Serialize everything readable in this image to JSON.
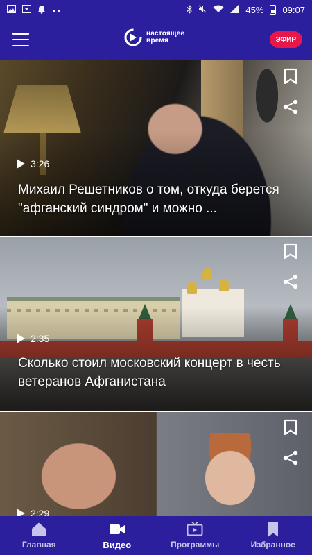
{
  "status_bar": {
    "battery": "45%",
    "time": "09:07",
    "left_icons": [
      "image-icon",
      "download-icon",
      "notification-icon",
      "more-dots-icon"
    ],
    "right_icons": [
      "bluetooth-icon",
      "mute-icon",
      "wifi-icon",
      "signal-icon",
      "battery-icon"
    ]
  },
  "app_bar": {
    "logo_line1": "настоящее",
    "logo_line2": "время",
    "live_button": "ЭФИР",
    "colors": {
      "bar": "#2b1f9e",
      "live": "#e8174b"
    }
  },
  "feed": {
    "items": [
      {
        "duration": "3:26",
        "title": "Михаил Решетников о том, откуда берется \"афганский синдром\" и можно ..."
      },
      {
        "duration": "2:35",
        "title": "Сколько стоил московский концерт в честь ветеранов Афганистана"
      },
      {
        "duration": "2:29",
        "title": ""
      }
    ]
  },
  "bottom_nav": {
    "items": [
      {
        "label": "Главная",
        "icon": "home-icon"
      },
      {
        "label": "Видео",
        "icon": "video-camera-icon"
      },
      {
        "label": "Программы",
        "icon": "tv-icon"
      },
      {
        "label": "Избранное",
        "icon": "bookmark-icon"
      }
    ],
    "active_index": 1
  }
}
